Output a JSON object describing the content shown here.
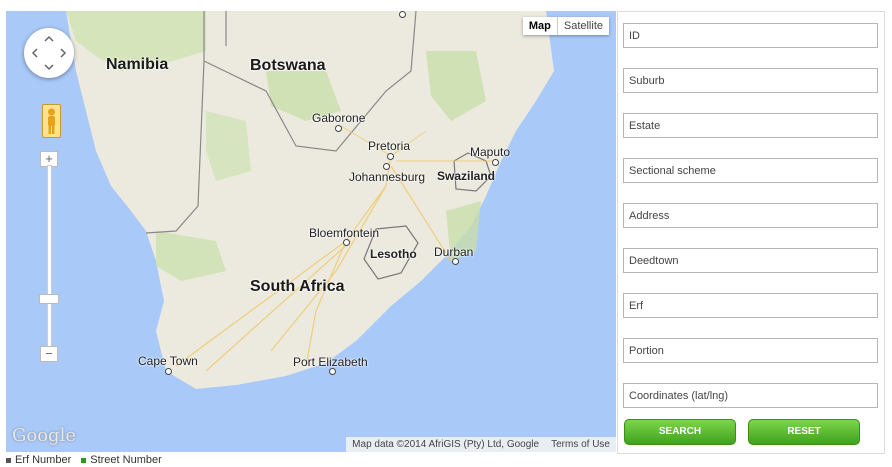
{
  "map": {
    "type_buttons": [
      "Map",
      "Satellite"
    ],
    "google_logo": "Google",
    "attribution": "Map data ©2014 AfriGIS (Pty) Ltd, Google",
    "terms": "Terms of Use",
    "zoom_in": "+",
    "zoom_out": "−",
    "labels": {
      "namibia": "Namibia",
      "botswana": "Botswana",
      "south_africa": "South Africa",
      "swaziland": "Swaziland",
      "lesotho": "Lesotho",
      "gaborone": "Gaborone",
      "pretoria": "Pretoria",
      "johannesburg": "Johannesburg",
      "maputo": "Maputo",
      "bloemfontein": "Bloemfontein",
      "durban": "Durban",
      "cape_town": "Cape Town",
      "port_elizabeth": "Port Elizabeth"
    }
  },
  "form": {
    "fields": [
      {
        "placeholder": "ID"
      },
      {
        "placeholder": "Suburb"
      },
      {
        "placeholder": "Estate"
      },
      {
        "placeholder": "Sectional scheme"
      },
      {
        "placeholder": "Address"
      },
      {
        "placeholder": "Deedtown"
      },
      {
        "placeholder": "Erf"
      },
      {
        "placeholder": "Portion"
      },
      {
        "placeholder": "Coordinates (lat/lng)"
      }
    ],
    "search_label": "SEARCH",
    "reset_label": "RESET"
  },
  "legend": {
    "items": [
      {
        "label": "Erf Number",
        "color": "#555555"
      },
      {
        "label": "Street Number",
        "color": "#2a9a1a"
      }
    ]
  },
  "colors": {
    "water": "#a9c9f9",
    "land": "#eceadf",
    "green": "#c8dfaa",
    "button": "#4caf20"
  }
}
